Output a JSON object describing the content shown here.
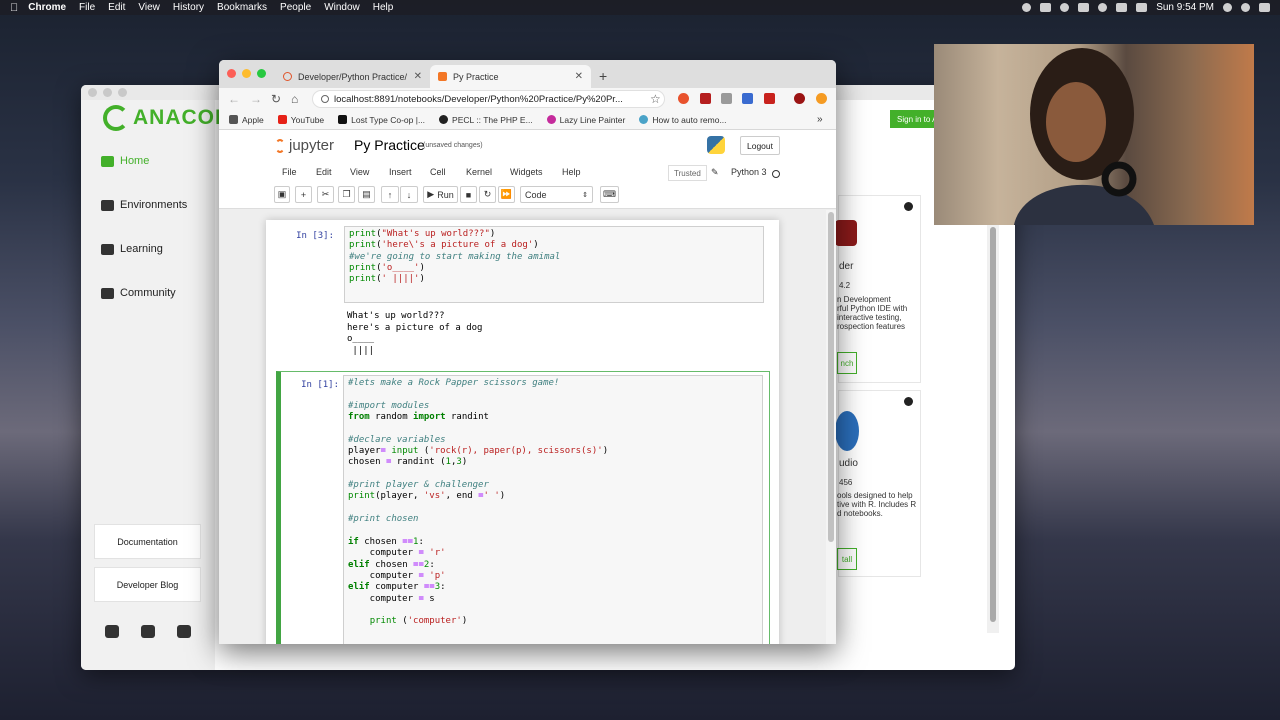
{
  "menubar": {
    "app": "Chrome",
    "items": [
      "File",
      "Edit",
      "View",
      "History",
      "Bookmarks",
      "People",
      "Window",
      "Help"
    ],
    "clock": "Sun 9:54 PM"
  },
  "anaconda": {
    "logo_text": "ANACON",
    "nav": [
      "Home",
      "Environments",
      "Learning",
      "Community"
    ],
    "links": [
      "Documentation",
      "Developer Blog"
    ],
    "signin": "Sign in to A",
    "card1": {
      "name": "der",
      "version": "4.2",
      "desc": [
        "n Development",
        "rful Python IDE with",
        "interactive testing,",
        "rospection features"
      ],
      "button": "nch"
    },
    "card2": {
      "name": "udio",
      "version": "456",
      "desc": [
        "ools designed to help",
        "tive with R. Includes R",
        "d notebooks."
      ],
      "button": "tall"
    }
  },
  "chrome": {
    "tabs": [
      {
        "title": "Developer/Python Practice/"
      },
      {
        "title": "Py Practice"
      }
    ],
    "url": "localhost:8891/notebooks/Developer/Python%20Practice/Py%20Pr...",
    "bookmarks": [
      "Apple",
      "YouTube",
      "Lost Type Co-op |...",
      "PECL :: The PHP E...",
      "Lazy Line Painter",
      "How to auto remo..."
    ],
    "bookmarks_more": "»"
  },
  "jupyter": {
    "brand": "jupyter",
    "notebook_name": "Py Practice",
    "save_status": "(unsaved changes)",
    "logout": "Logout",
    "menu": [
      "File",
      "Edit",
      "View",
      "Insert",
      "Cell",
      "Kernel",
      "Widgets",
      "Help"
    ],
    "trusted": "Trusted",
    "kernel": "Python 3",
    "run_label": "Run",
    "cell_type": "Code"
  },
  "cells": [
    {
      "prompt": "In [3]:",
      "output": "What's up world???\nhere's a picture of a dog\no____\n |||| "
    },
    {
      "prompt": "In [1]:"
    }
  ]
}
